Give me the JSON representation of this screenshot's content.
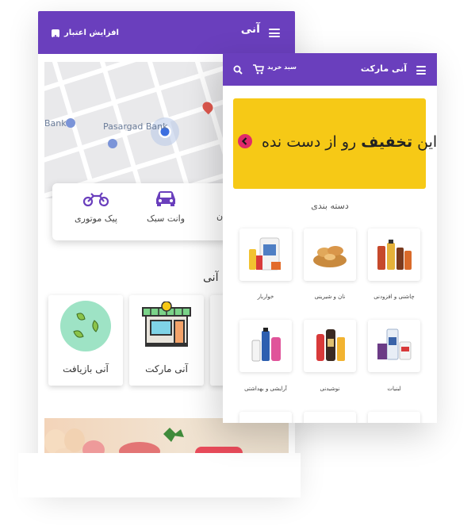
{
  "back_screen": {
    "header": {
      "title": "آنی",
      "credit_label": "افزایش اعتبار"
    },
    "map": {
      "bank_label": "Pasargad Bank",
      "bank_label_left": "Bank"
    },
    "vehicles": [
      {
        "label": "پیک موتوری",
        "icon": "motorcycle-icon"
      },
      {
        "label": "وانت سبک",
        "icon": "car-icon"
      },
      {
        "label": "ن",
        "icon": "truck-icon"
      }
    ],
    "section_title": "آنی",
    "services": [
      {
        "label": "آنی بازیافت",
        "icon": "recycle-icon"
      },
      {
        "label": "آنی مارکت",
        "icon": "store-icon"
      }
    ]
  },
  "front_screen": {
    "header": {
      "title": "آنی مارکت",
      "cart_label": "سبد خرید"
    },
    "promo": {
      "prefix": "این",
      "highlight": "تخفیف",
      "suffix": "رو از دست نده"
    },
    "categories_title": "دسته بندی",
    "categories": [
      {
        "label": "چاشنی و افزودنی",
        "icon": "condiments-icon"
      },
      {
        "label": "نان و شیرینی",
        "icon": "bread-icon"
      },
      {
        "label": "خواربار",
        "icon": "groceries-icon"
      },
      {
        "label": "لبنیات",
        "icon": "dairy-icon"
      },
      {
        "label": "نوشیدنی",
        "icon": "drinks-icon"
      },
      {
        "label": "آرایشی و بهداشتی",
        "icon": "cosmetics-icon"
      }
    ]
  },
  "colors": {
    "brand": "#6a3fbd",
    "promo": "#f6c916",
    "accent": "#e02a6a"
  }
}
